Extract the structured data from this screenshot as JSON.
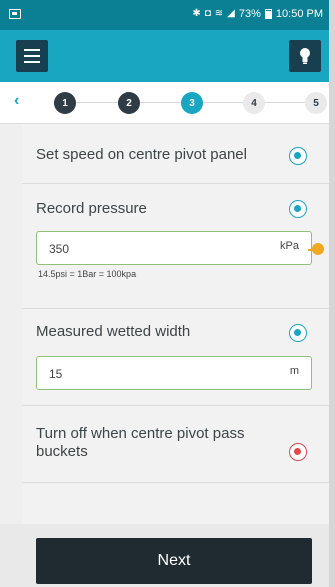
{
  "status_bar": {
    "battery_percent": "73%",
    "time": "10:50 PM"
  },
  "stepper": {
    "steps": [
      "1",
      "2",
      "3",
      "4",
      "5"
    ],
    "active_step": "3",
    "completed_steps": [
      "1",
      "2"
    ]
  },
  "items": {
    "set_speed": {
      "label": "Set speed on centre pivot panel",
      "selected": true
    },
    "record_pressure": {
      "label": "Record pressure",
      "selected": true,
      "value": "350",
      "unit": "kPa",
      "hint": "14.5psi = 1Bar = 100kpa"
    },
    "wetted_width": {
      "label": "Measured wetted width",
      "selected": true,
      "value": "15",
      "unit": "m"
    },
    "turn_off": {
      "label": "Turn off when centre pivot pass buckets",
      "selected": true
    }
  },
  "footer": {
    "next_label": "Next"
  },
  "colors": {
    "status_bar": "#0b7f93",
    "app_bar": "#19a6c1",
    "dark_button": "#1f2b31",
    "accent_radio": "#19a6c1",
    "alert_radio": "#e04a4a",
    "pointer": "#f0a821",
    "input_border": "#8fc07a"
  },
  "icons": {
    "menu": "hamburger-icon",
    "bulb": "lightbulb-icon",
    "back": "chevron-left-icon"
  }
}
